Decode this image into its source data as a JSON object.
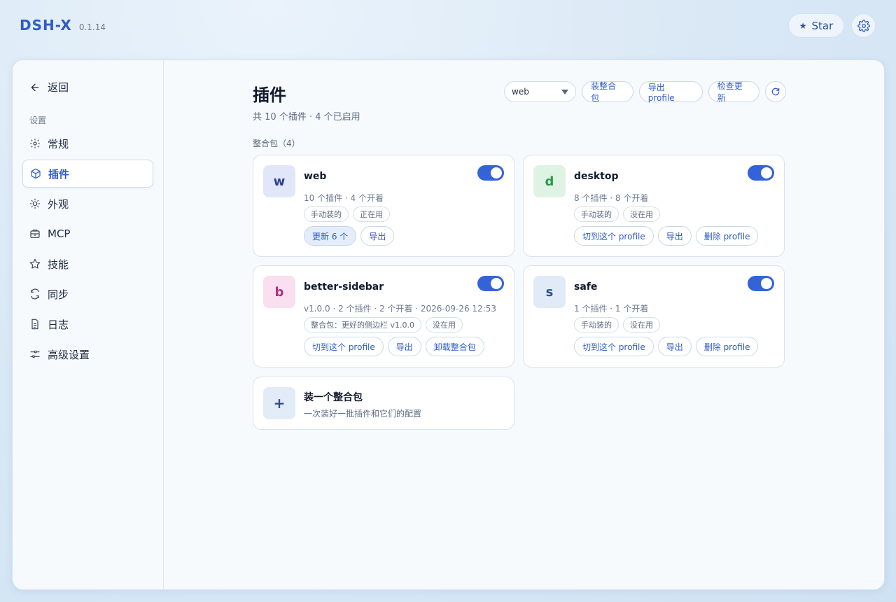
{
  "app": {
    "name": "DSH-X",
    "version": "0.1.14"
  },
  "header": {
    "star_label": "Star"
  },
  "sidebar": {
    "back_label": "返回",
    "section_label": "设置",
    "items": [
      {
        "label": "常规",
        "icon": "gear-icon"
      },
      {
        "label": "插件",
        "icon": "cube-icon",
        "active": true
      },
      {
        "label": "外观",
        "icon": "sun-icon"
      },
      {
        "label": "MCP",
        "icon": "server-icon"
      },
      {
        "label": "技能",
        "icon": "star-outline-icon"
      },
      {
        "label": "同步",
        "icon": "sync-icon"
      },
      {
        "label": "日志",
        "icon": "document-icon"
      },
      {
        "label": "高级设置",
        "icon": "sliders-icon"
      }
    ]
  },
  "main": {
    "title": "插件",
    "subtitle": "共 10 个插件 · 4 个已启用",
    "toolbar": {
      "profile_select": "web",
      "install_pack": "装整合包",
      "export_profile": "导出 profile",
      "check_updates": "检查更新"
    },
    "group_label": "整合包（4）",
    "cards": [
      {
        "letter": "w",
        "name": "web",
        "meta": "10 个插件 · 4 个开着",
        "tags": [
          "手动装的",
          "正在用"
        ],
        "actions": [
          "更新 6 个",
          "导出"
        ],
        "enabled": true
      },
      {
        "letter": "d",
        "name": "desktop",
        "meta": "8 个插件 · 8 个开着",
        "tags": [
          "手动装的",
          "没在用"
        ],
        "actions": [
          "切到这个 profile",
          "导出",
          "删除 profile"
        ],
        "enabled": true
      },
      {
        "letter": "b",
        "name": "better-sidebar",
        "meta": "v1.0.0 · 2 个插件 · 2 个开着 · 2026-09-26 12:53",
        "tags": [
          "整合包：更好的侧边栏 v1.0.0",
          "没在用"
        ],
        "actions": [
          "切到这个 profile",
          "导出",
          "卸载整合包"
        ],
        "enabled": true
      },
      {
        "letter": "s",
        "name": "safe",
        "meta": "1 个插件 · 1 个开着",
        "tags": [
          "手动装的",
          "没在用"
        ],
        "actions": [
          "切到这个 profile",
          "导出",
          "删除 profile"
        ],
        "enabled": true
      }
    ],
    "add_pack": {
      "symbol": "+",
      "title": "装一个整合包",
      "subtitle": "一次装好一批插件和它们的配置"
    }
  },
  "colors": {
    "accent": "#3463d8",
    "brand": "#2f5cc9"
  }
}
